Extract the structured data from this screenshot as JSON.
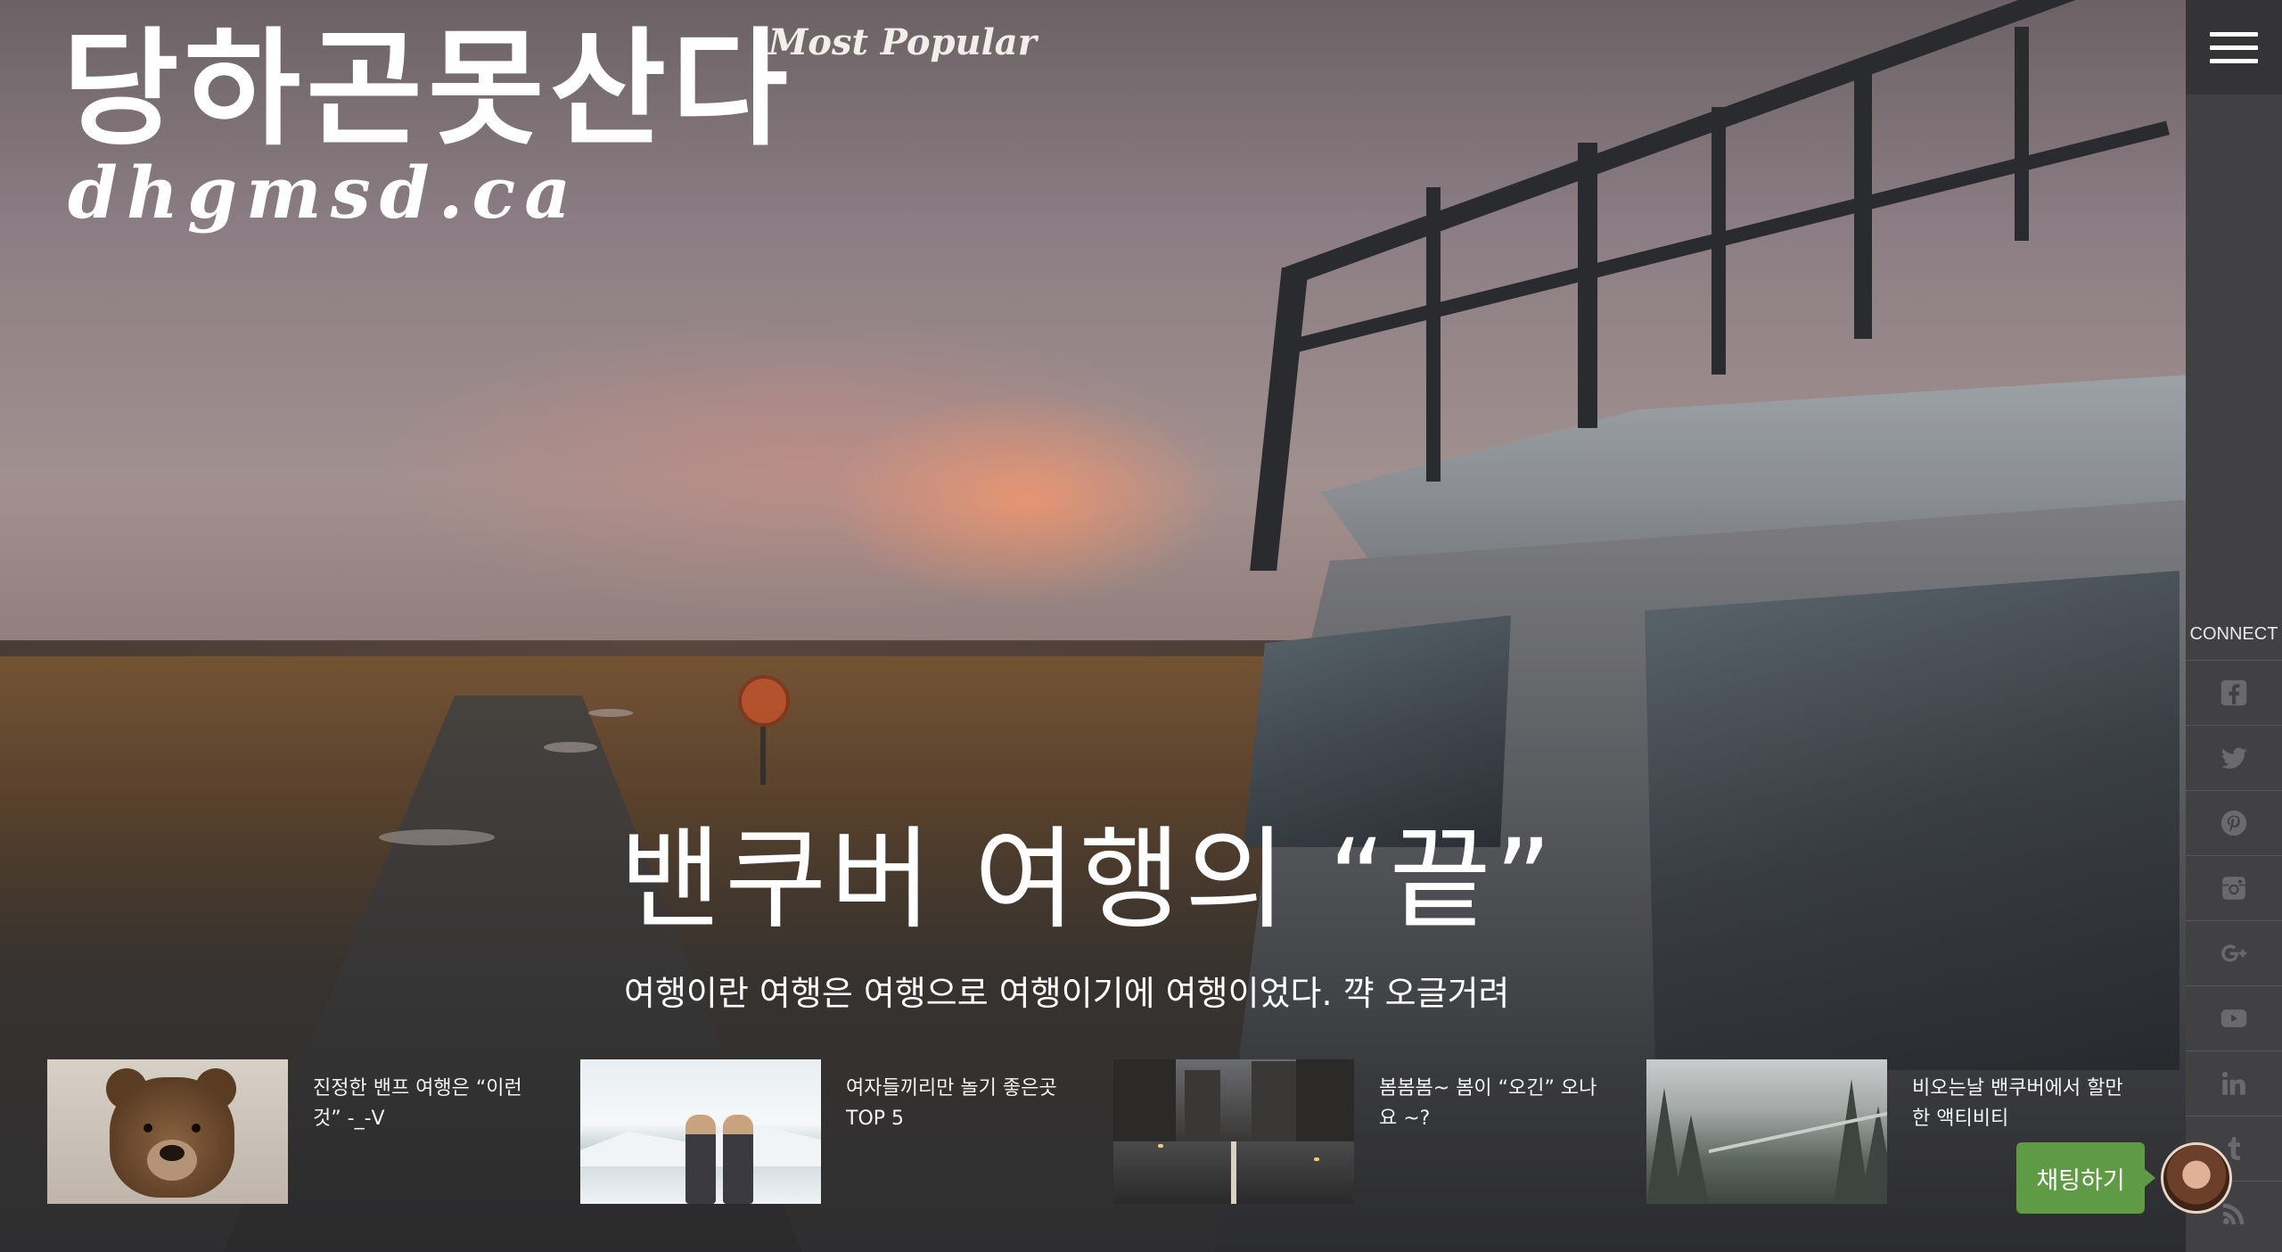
{
  "logo": {
    "korean": "당하곤못산다",
    "english": "dhgmsd.ca"
  },
  "nav": {
    "most_popular": "Most Popular"
  },
  "hero": {
    "headline": "밴쿠버 여행의 “끝”",
    "subheadline": "여행이란 여행은 여행으로 여행이기에 여행이었다. 꺅 오글거려"
  },
  "cards": [
    {
      "title": "진정한 밴프 여행은 “이런 것” -_-V",
      "thumb": "bear"
    },
    {
      "title": "여자들끼리만 놀기 좋은곳 TOP 5",
      "thumb": "snow"
    },
    {
      "title": "봄봄봄~ 봄이 “오긴” 오나요 ~?",
      "thumb": "city"
    },
    {
      "title": "비오는날 밴쿠버에서 할만한 액티비티",
      "thumb": "forest"
    }
  ],
  "sidebar": {
    "connect_label": "CONNECT",
    "social": [
      "facebook-icon",
      "twitter-icon",
      "pinterest-icon",
      "instagram-icon",
      "google-plus-icon",
      "youtube-icon",
      "linkedin-icon",
      "tumblr-icon",
      "rss-icon"
    ]
  },
  "chat": {
    "label": "채팅하기"
  },
  "colors": {
    "sidebar_bg": "#414144",
    "menu_bg": "#343436",
    "chat_green": "#5f9a44",
    "icon_gray": "#6a6a6e"
  }
}
